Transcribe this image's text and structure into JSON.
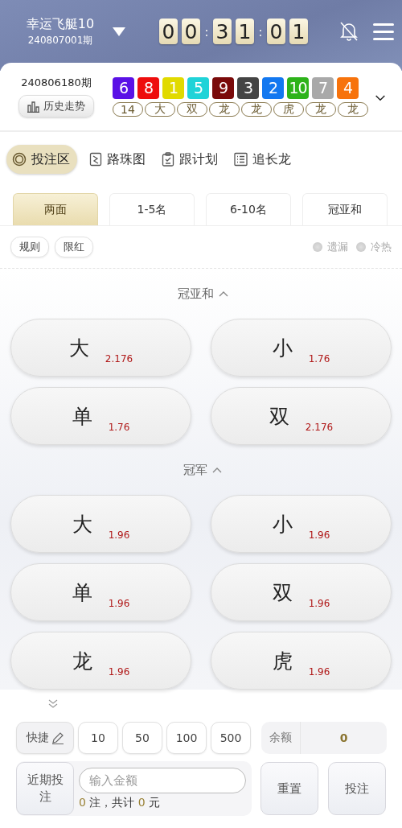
{
  "header": {
    "title": "幸运飞艇10",
    "issue": "240807001期",
    "countdown": [
      [
        "0",
        "0"
      ],
      [
        "3",
        "1"
      ],
      [
        "0",
        "1"
      ]
    ],
    "separator": ":"
  },
  "last_draw": {
    "issue": "240806180期",
    "history_button": "历史走势",
    "balls": [
      {
        "number": "6",
        "color": "#5a11e6"
      },
      {
        "number": "8",
        "color": "#ee0d0d"
      },
      {
        "number": "1",
        "color": "#e1da00"
      },
      {
        "number": "5",
        "color": "#20d3d8"
      },
      {
        "number": "9",
        "color": "#7a0a0a"
      },
      {
        "number": "3",
        "color": "#444444"
      },
      {
        "number": "2",
        "color": "#1378f0"
      },
      {
        "number": "10",
        "color": "#2db31a"
      },
      {
        "number": "7",
        "color": "#a9a9a9"
      },
      {
        "number": "4",
        "color": "#f7730c"
      }
    ],
    "tags": [
      "14",
      "大",
      "双",
      "龙",
      "龙",
      "虎",
      "龙",
      "龙"
    ]
  },
  "nav_tabs": [
    {
      "label": "投注区",
      "selected": true
    },
    {
      "label": "路珠图",
      "selected": false
    },
    {
      "label": "跟计划",
      "selected": false
    },
    {
      "label": "追长龙",
      "selected": false
    }
  ],
  "play_tabs": [
    {
      "label": "两面",
      "selected": true
    },
    {
      "label": "1-5名",
      "selected": false
    },
    {
      "label": "6-10名",
      "selected": false
    },
    {
      "label": "冠亚和",
      "selected": false
    }
  ],
  "pills": [
    "规则",
    "限红"
  ],
  "toggles": [
    {
      "label": "遗漏",
      "checked": false
    },
    {
      "label": "冷热",
      "checked": false
    }
  ],
  "sections": [
    {
      "title": "冠亚和",
      "expanded": true,
      "bets": [
        {
          "name": "大",
          "odds": "2.176"
        },
        {
          "name": "小",
          "odds": "1.76"
        },
        {
          "name": "单",
          "odds": "1.76"
        },
        {
          "name": "双",
          "odds": "2.176"
        }
      ]
    },
    {
      "title": "冠军",
      "expanded": true,
      "bets": [
        {
          "name": "大",
          "odds": "1.96"
        },
        {
          "name": "小",
          "odds": "1.96"
        },
        {
          "name": "单",
          "odds": "1.96"
        },
        {
          "name": "双",
          "odds": "1.96"
        },
        {
          "name": "龙",
          "odds": "1.96"
        },
        {
          "name": "虎",
          "odds": "1.96"
        }
      ]
    }
  ],
  "footer": {
    "quick_label": "快捷",
    "chips": [
      "10",
      "50",
      "100",
      "500"
    ],
    "balance_label": "余额",
    "balance": "0",
    "recent_button": "近期投注",
    "amount_placeholder": "输入金额",
    "summary": {
      "count": "0",
      "count_unit": "注，共计",
      "total": "0",
      "total_unit": "元"
    },
    "reset_button": "重置",
    "submit_button": "投注"
  }
}
